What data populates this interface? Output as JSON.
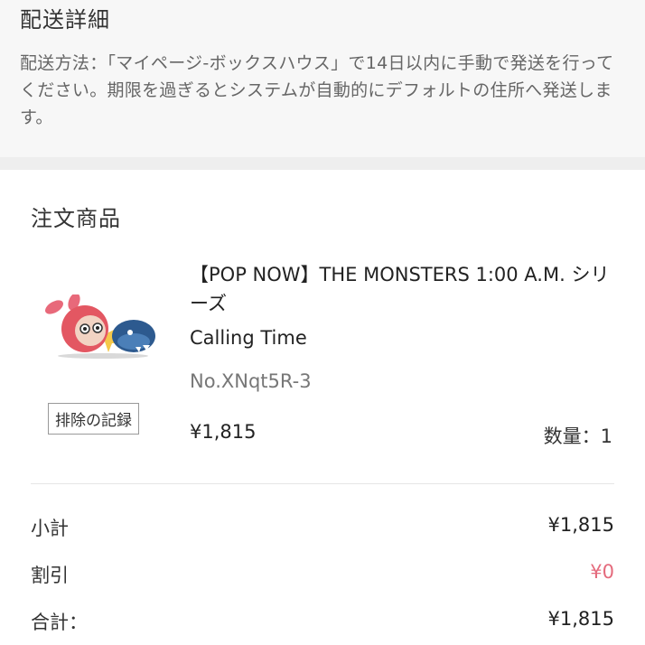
{
  "delivery": {
    "title": "配送詳細",
    "note": "配送方法：「マイページ-ボックスハウス」で14日以内に手動で発送を行ってください。期限を過ぎるとシステムが自動的にデフォルトの住所へ発送します。"
  },
  "order": {
    "title": "注文商品",
    "product": {
      "name": "【POP NOW】THE MONSTERS 1:00 A.M. シリーズ",
      "variant": "Calling Time",
      "serial": "No.XNqt5R-3",
      "price": "¥1,815",
      "quantity": "数量：1",
      "exclude_button": "排除の記録",
      "image_icon": "monster-figure-image"
    }
  },
  "summary": {
    "subtotal_label": "小計",
    "subtotal_value": "¥1,815",
    "discount_label": "割引",
    "discount_value": "¥0",
    "total_label": "合計：",
    "total_value": "¥1,815"
  },
  "colors": {
    "discount": "#e46a7c",
    "top_background": "#f7f7f7",
    "band": "#eeeeee"
  }
}
